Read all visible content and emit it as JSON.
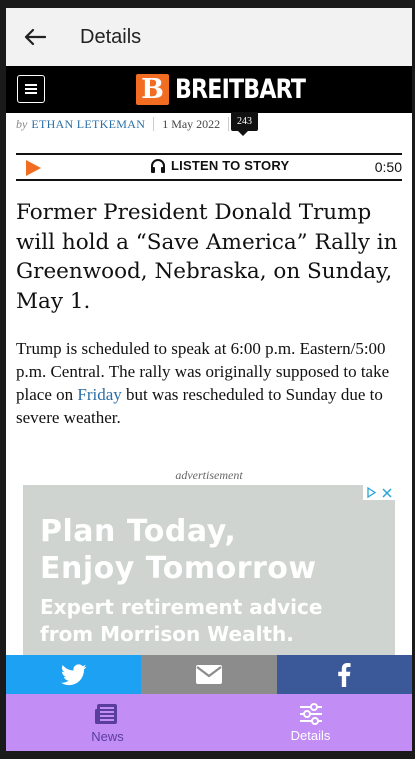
{
  "appbar": {
    "title": "Details"
  },
  "header": {
    "logo_text": "BREITBART",
    "logo_mark": "B"
  },
  "byline": {
    "prefix": "by",
    "author": "ETHAN LETKEMAN",
    "date": "1 May 2022",
    "comments": "243"
  },
  "listen": {
    "label": "LISTEN TO STORY",
    "time": "0:50"
  },
  "article": {
    "headline": "Former President Donald Trump will hold a “Save America” Rally in Greenwood, Nebraska, on Sunday, May 1.",
    "body_before": "Trump is scheduled to speak at 6:00 p.m. Eastern/5:00 p.m. Central. The rally was originally supposed to take place on ",
    "body_link": "Friday",
    "body_after": " but was rescheduled to Sunday due to severe weather."
  },
  "ad": {
    "label": "advertisement",
    "headline_line1": "Plan Today,",
    "headline_line2": "Enjoy Tomorrow",
    "sub_line1": "Expert retirement advice",
    "sub_line2": "from Morrison Wealth."
  },
  "share": {
    "twitter_icon": "twitter-icon",
    "email_icon": "email-icon",
    "facebook_icon": "facebook-icon"
  },
  "bottom_nav": {
    "items": [
      {
        "label": "News",
        "icon": "newspaper-icon"
      },
      {
        "label": "Details",
        "icon": "sliders-icon"
      }
    ]
  },
  "colors": {
    "brand_orange": "#f26c21",
    "nav_purple": "#c28df5",
    "twitter": "#1da1f2",
    "facebook": "#3b5998",
    "link_blue": "#2a6fa8"
  }
}
